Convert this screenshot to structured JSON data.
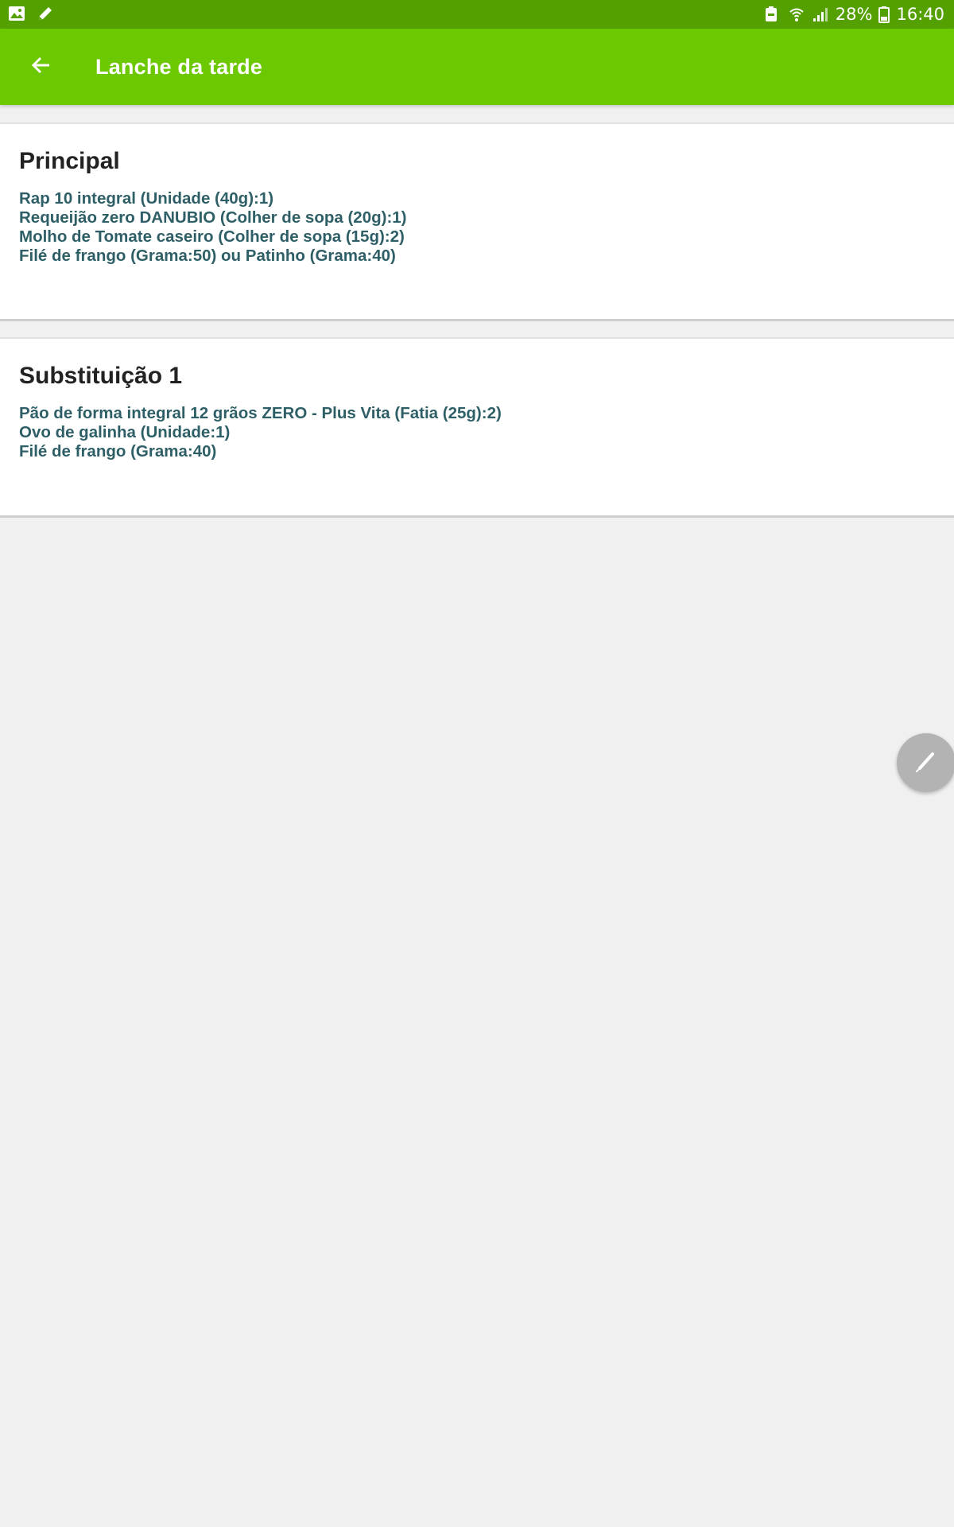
{
  "status_bar": {
    "battery": "28%",
    "time": "16:40",
    "icons": [
      "gallery-icon",
      "pencil-icon",
      "battery-saver-icon",
      "wifi-icon",
      "signal-icon",
      "battery-icon"
    ]
  },
  "app_bar": {
    "title": "Lanche da tarde",
    "back_icon": "arrow-back-icon",
    "background": "#6cc800",
    "status_background": "#54a000"
  },
  "sections": [
    {
      "title": "Principal",
      "items": [
        "Rap 10 integral (Unidade (40g):1)",
        "Requeijão zero DANUBIO  (Colher de sopa (20g):1)",
        "Molho de Tomate caseiro  (Colher de sopa (15g):2)",
        "Filé de frango  (Grama:50) ou Patinho (Grama:40)"
      ]
    },
    {
      "title": "Substituição 1",
      "items": [
        "Pão de forma integral 12 grãos ZERO - Plus Vita (Fatia (25g):2)",
        "Ovo de galinha  (Unidade:1)",
        "Filé de frango  (Grama:40)"
      ]
    }
  ],
  "fab": {
    "icon": "pencil-icon",
    "color": "#b3b3b3"
  },
  "colors": {
    "item_text": "#2e5f66",
    "background": "#f0f0f0"
  }
}
